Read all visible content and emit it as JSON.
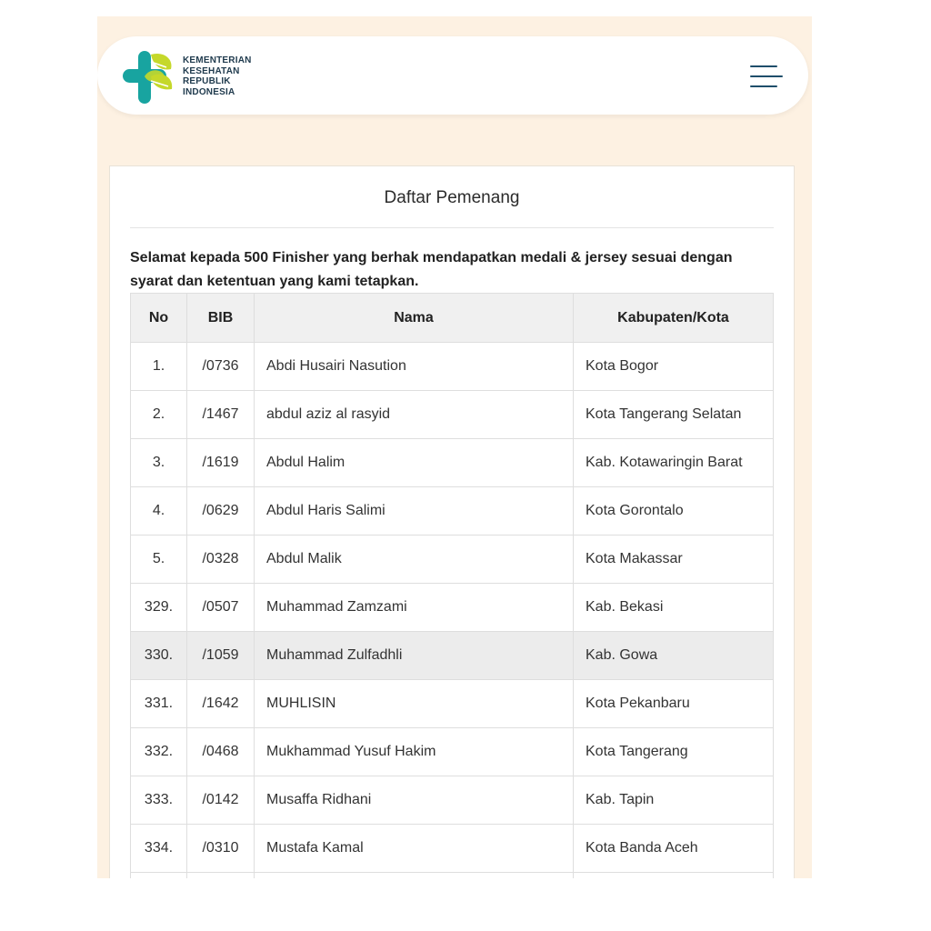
{
  "brand": {
    "logo_lines": [
      "KEMENTERIAN",
      "KESEHATAN",
      "REPUBLIK",
      "INDONESIA"
    ],
    "colors": {
      "teal": "#18a4a0",
      "lime": "#c5d82a",
      "dark": "#1f3a4d"
    }
  },
  "header": {
    "menu_icon": "hamburger-menu-icon"
  },
  "card": {
    "title": "Daftar Pemenang",
    "intro": "Selamat kepada 500 Finisher yang berhak mendapatkan medali & jersey sesuai dengan syarat dan ketentuan yang kami tetapkan."
  },
  "table": {
    "headers": [
      "No",
      "BIB",
      "Nama",
      "Kabupaten/Kota"
    ],
    "rows": [
      {
        "no": "1.",
        "bib": "/0736",
        "nama": "Abdi Husairi Nasution",
        "kota": "Kota Bogor"
      },
      {
        "no": "2.",
        "bib": "/1467",
        "nama": "abdul aziz al rasyid",
        "kota": "Kota Tangerang Selatan"
      },
      {
        "no": "3.",
        "bib": "/1619",
        "nama": "Abdul Halim",
        "kota": "Kab. Kotawaringin Barat"
      },
      {
        "no": "4.",
        "bib": "/0629",
        "nama": "Abdul Haris Salimi",
        "kota": "Kota Gorontalo"
      },
      {
        "no": "5.",
        "bib": "/0328",
        "nama": "Abdul Malik",
        "kota": "Kota Makassar"
      },
      {
        "no": "329.",
        "bib": "/0507",
        "nama": "Muhammad Zamzami",
        "kota": "Kab. Bekasi"
      },
      {
        "no": "330.",
        "bib": "/1059",
        "nama": "Muhammad Zulfadhli",
        "kota": "Kab. Gowa",
        "highlight": true
      },
      {
        "no": "331.",
        "bib": "/1642",
        "nama": "MUHLISIN",
        "kota": "Kota Pekanbaru"
      },
      {
        "no": "332.",
        "bib": "/0468",
        "nama": "Mukhammad Yusuf Hakim",
        "kota": "Kota Tangerang"
      },
      {
        "no": "333.",
        "bib": "/0142",
        "nama": "Musaffa Ridhani",
        "kota": "Kab. Tapin"
      },
      {
        "no": "334.",
        "bib": "/0310",
        "nama": "Mustafa Kamal",
        "kota": "Kota Banda Aceh"
      },
      {
        "no": "",
        "bib": "",
        "nama": "",
        "kota": ""
      }
    ]
  }
}
